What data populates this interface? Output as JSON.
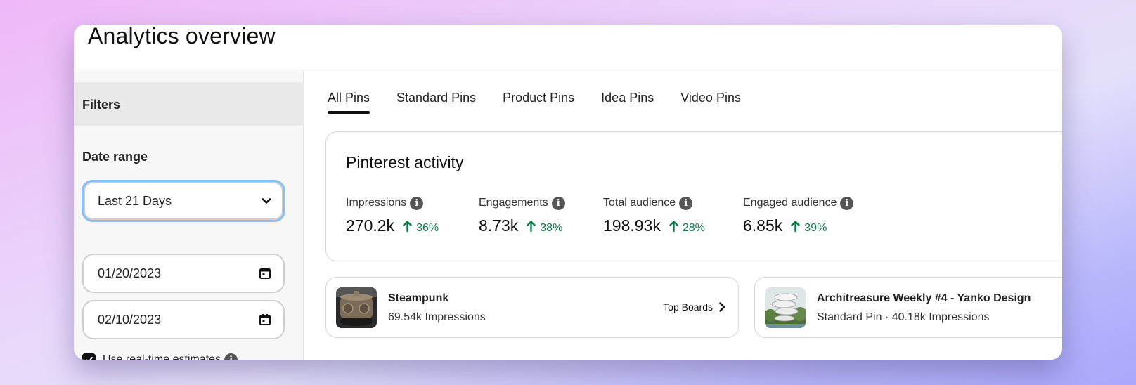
{
  "header": {
    "title": "Analytics overview"
  },
  "sidebar": {
    "filters_label": "Filters",
    "date_range_label": "Date range",
    "date_range_select": {
      "value": "Last 21 Days",
      "icon": "chevron-down-icon"
    },
    "start_date": {
      "value": "01/20/2023",
      "icon": "calendar-icon"
    },
    "end_date": {
      "value": "02/10/2023",
      "icon": "calendar-icon"
    },
    "realtime_checkbox": {
      "label": "Use real-time estimates",
      "checked": true,
      "info_icon": "info-icon"
    }
  },
  "tabs": [
    {
      "label": "All Pins",
      "active": true
    },
    {
      "label": "Standard Pins",
      "active": false
    },
    {
      "label": "Product Pins",
      "active": false
    },
    {
      "label": "Idea Pins",
      "active": false
    },
    {
      "label": "Video Pins",
      "active": false
    }
  ],
  "activity": {
    "title": "Pinterest activity",
    "metrics": [
      {
        "label": "Impressions",
        "value": "270.2k",
        "change": "36%",
        "trend": "up"
      },
      {
        "label": "Engagements",
        "value": "8.73k",
        "change": "38%",
        "trend": "up"
      },
      {
        "label": "Total audience",
        "value": "198.93k",
        "change": "28%",
        "trend": "up"
      },
      {
        "label": "Engaged audience",
        "value": "6.85k",
        "change": "39%",
        "trend": "up"
      }
    ],
    "colors": {
      "positive": "#0a7a4a",
      "focus_ring": "#86bef7"
    }
  },
  "pin_cards": [
    {
      "title": "Steampunk",
      "subtitle": "69.54k Impressions",
      "action_label": "Top Boards",
      "action_icon": "chevron-right-icon"
    },
    {
      "title": "Architreasure Weekly #4 - Yanko Design",
      "subtitle": "Standard Pin · 40.18k Impressions"
    }
  ]
}
